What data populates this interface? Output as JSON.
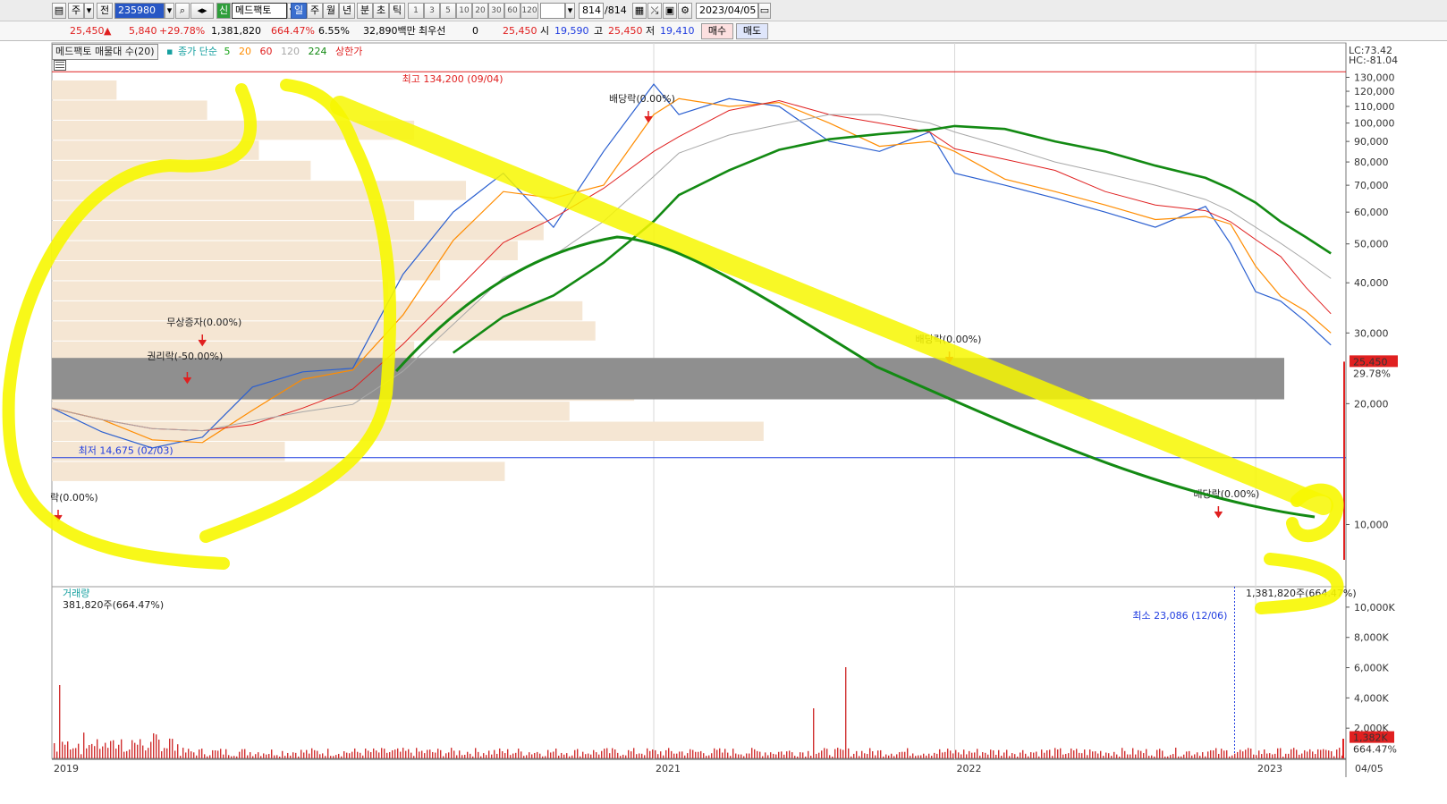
{
  "toolbar": {
    "tab_stock": "주",
    "tab_all": "전",
    "stock_code": "235980",
    "stock_badge": "신",
    "stock_name": "메드팩토",
    "periods": [
      "일",
      "주",
      "월",
      "년",
      "분",
      "초",
      "틱"
    ],
    "active_period": "일",
    "intervals": [
      "1",
      "3",
      "5",
      "10",
      "20",
      "30",
      "60",
      "120"
    ],
    "count": "814",
    "count_total": "/814",
    "date": "2023/04/05"
  },
  "quote": {
    "price": "25,450",
    "change": "5,840",
    "change_pct": "+29.78%",
    "volume": "1,381,820",
    "volume_ratio": "664.47%",
    "turnover": "6.55%",
    "amount": "32,890백만",
    "priority_label": "최우선",
    "priority_qty": "0",
    "bid_price": "25,450",
    "open_label": "시",
    "open": "19,590",
    "high_label": "고",
    "high": "25,450",
    "low_label": "저",
    "low": "19,410",
    "buy_label": "매수",
    "sell_label": "매도"
  },
  "legend": {
    "volume_profile": "메드팩토 매물대 수(20)",
    "ma_label": "종가 단순",
    "ma5": "5",
    "ma20": "20",
    "ma60": "60",
    "ma120": "120",
    "ma224": "224",
    "upper_limit": "상한가"
  },
  "chart_data": [
    {
      "type": "line",
      "name": "price",
      "lc_label": "LC:73.42",
      "hc_label": "HC:-81.04",
      "ylim": [
        7000,
        140000
      ],
      "y_ticks": [
        10000,
        20000,
        30000,
        40000,
        50000,
        60000,
        70000,
        80000,
        90000,
        100000,
        110000,
        120000,
        130000
      ],
      "y_tick_labels": [
        "10,000",
        "20,000",
        "30,000",
        "40,000",
        "50,000",
        "60,000",
        "70,000",
        "80,000",
        "90,000",
        "100,000",
        "110,000",
        "120,000",
        "130,000"
      ],
      "x_labels": [
        "2019",
        "2021",
        "2022",
        "2023",
        "04/05"
      ],
      "x": [
        "2019-01",
        "2019-03",
        "2019-05",
        "2019-07",
        "2019-09",
        "2019-11",
        "2020-01",
        "2020-03",
        "2020-05",
        "2020-07",
        "2020-09",
        "2020-11",
        "2021-01",
        "2021-02",
        "2021-04",
        "2021-06",
        "2021-08",
        "2021-10",
        "2021-12",
        "2022-01",
        "2022-03",
        "2022-05",
        "2022-07",
        "2022-09",
        "2022-11",
        "2022-12",
        "2023-01",
        "2023-02",
        "2023-03",
        "2023-04"
      ],
      "close": [
        19500,
        17000,
        15500,
        16500,
        22000,
        24000,
        24500,
        42000,
        60000,
        75000,
        55000,
        85000,
        125000,
        105000,
        115000,
        110000,
        90000,
        85000,
        95000,
        75000,
        70000,
        65000,
        60000,
        55000,
        62000,
        50000,
        38000,
        36000,
        32000,
        28000
      ],
      "ma_colors": {
        "ma5": "#1f6fe0",
        "ma20": "#ff8c00",
        "ma60": "#e02020",
        "ma120": "#a8a8a8",
        "ma224": "#138a13"
      },
      "series": [
        {
          "name": "5",
          "color": "#1f6fe0"
        },
        {
          "name": "20",
          "color": "#ff8c00"
        },
        {
          "name": "60",
          "color": "#e02020"
        },
        {
          "name": "120",
          "color": "#a8a8a8"
        },
        {
          "name": "224",
          "color": "#138a13"
        }
      ],
      "annotations": {
        "high": "최고 134,200 (09/04)",
        "low": "최저 14,675 (02/03)",
        "dividend": "배당락(0.00%)",
        "rights": "권리락(-50.00%)",
        "bonus": "무상증자(0.00%)",
        "left_cut": "락(0.00%)"
      },
      "high_value": 134200,
      "low_value": 14675,
      "last_price": "25,450",
      "last_pct": "29.78%"
    },
    {
      "type": "bar",
      "name": "volume",
      "title": "거래량",
      "sub_label": "381,820주(664.47%)",
      "right_label": "1,381,820주(664.47%)",
      "min_label": "최소 23,086 (12/06)",
      "y_ticks": [
        2000,
        4000,
        6000,
        8000,
        10000
      ],
      "y_tick_labels": [
        "2,000K",
        "4,000K",
        "6,000K",
        "8,000K",
        "10,000K"
      ],
      "ylim": [
        0,
        11000
      ],
      "last_volume": "1,382K",
      "last_pct": "664.47%"
    }
  ]
}
